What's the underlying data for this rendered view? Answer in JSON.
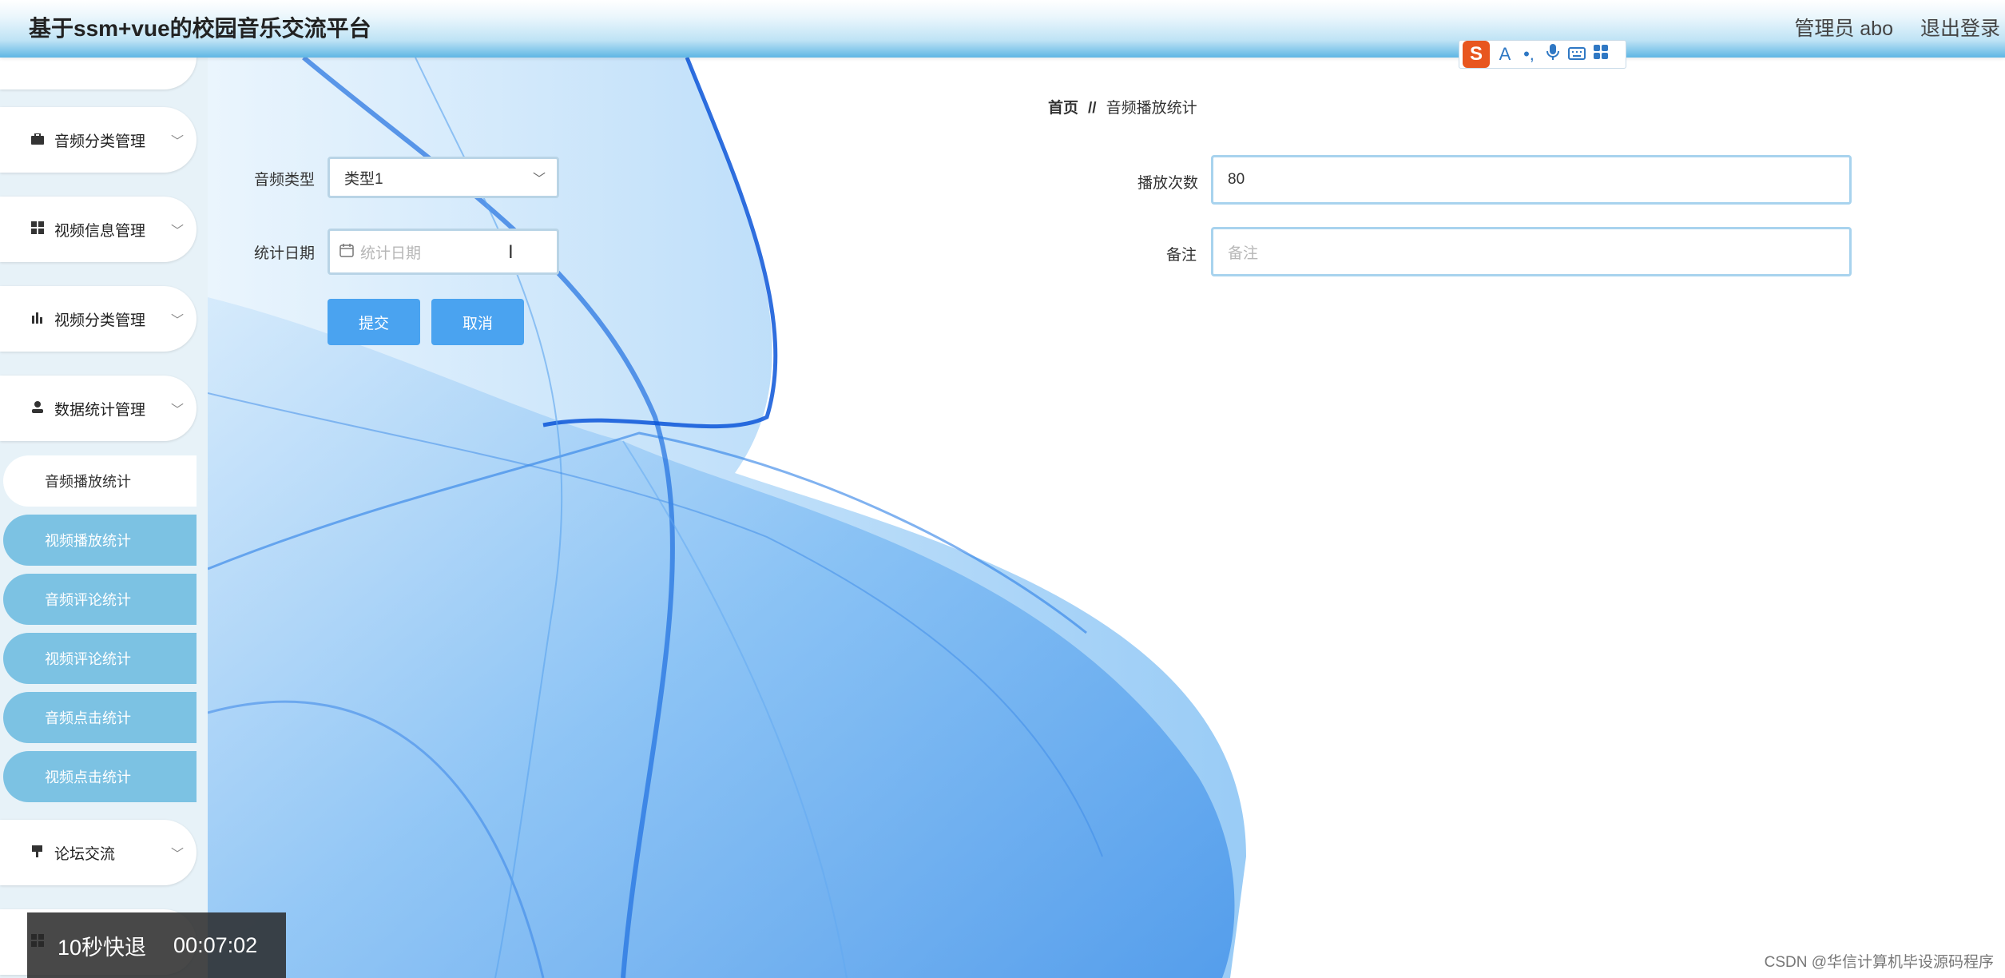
{
  "header": {
    "title": "基于ssm+vue的校园音乐交流平台",
    "user": "管理员 abo",
    "logout": "退出登录"
  },
  "ime_toolbar": {
    "logo": "S",
    "icons": [
      "font-icon",
      "punctuation-icon",
      "microphone-icon",
      "keyboard-icon",
      "grid-icon"
    ]
  },
  "sidebar": {
    "menus": [
      {
        "label": "音频分类管理",
        "icon": "briefcase-icon"
      },
      {
        "label": "视频信息管理",
        "icon": "grid-icon"
      },
      {
        "label": "视频分类管理",
        "icon": "bar-chart-icon"
      },
      {
        "label": "数据统计管理",
        "icon": "user-icon"
      },
      {
        "label": "论坛交流",
        "icon": "flag-icon"
      }
    ],
    "submenu": [
      {
        "label": "音频播放统计",
        "active": true
      },
      {
        "label": "视频播放统计",
        "active": false
      },
      {
        "label": "音频评论统计",
        "active": false
      },
      {
        "label": "视频评论统计",
        "active": false
      },
      {
        "label": "音频点击统计",
        "active": false
      },
      {
        "label": "视频点击统计",
        "active": false
      }
    ]
  },
  "breadcrumb": {
    "home": "首页",
    "separator": "//",
    "current": "音频播放统计"
  },
  "form": {
    "audio_type_label": "音频类型",
    "audio_type_value": "类型1",
    "stat_date_label": "统计日期",
    "stat_date_placeholder": "统计日期",
    "play_count_label": "播放次数",
    "play_count_value": "80",
    "remark_label": "备注",
    "remark_placeholder": "备注",
    "submit": "提交",
    "cancel": "取消"
  },
  "video_overlay": {
    "skip_label": "10秒快退",
    "timestamp": "00:07:02"
  },
  "watermark": "CSDN @华信计算机毕设源码程序",
  "colors": {
    "accent": "#4aa3f0",
    "submenu": "#7cc2e3",
    "input_border": "#a8d3ee",
    "header_bottom": "#5fb6e4"
  }
}
